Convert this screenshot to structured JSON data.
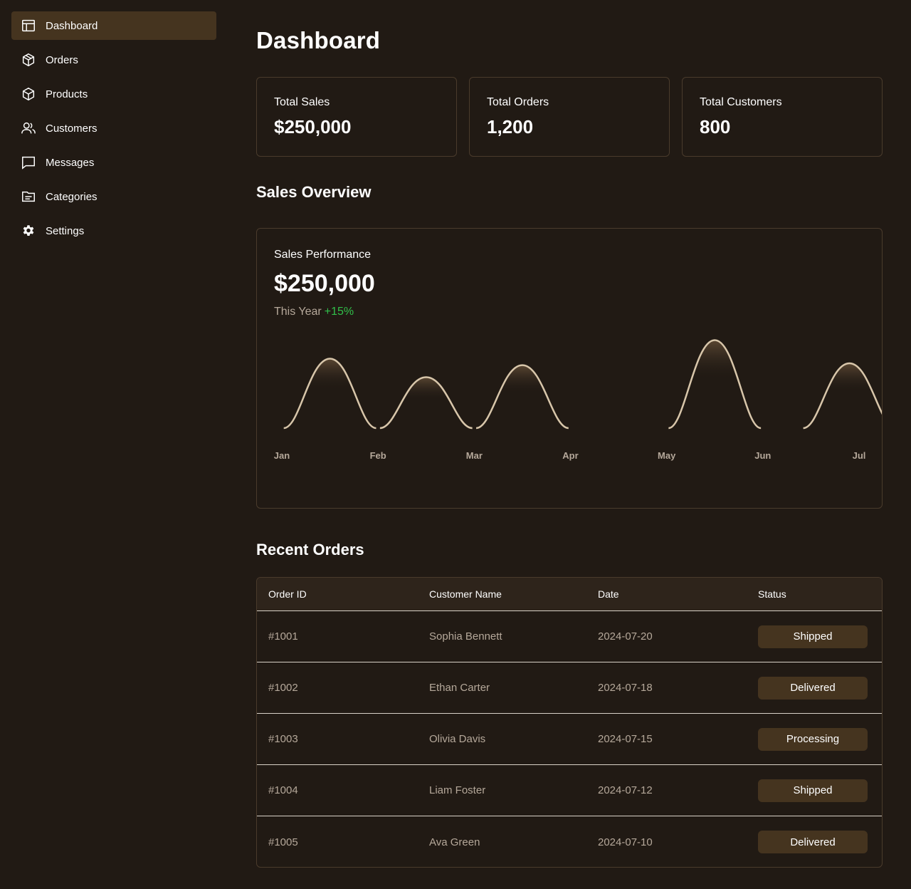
{
  "sidebar": {
    "items": [
      {
        "label": "Dashboard",
        "icon": "layout-icon",
        "active": true
      },
      {
        "label": "Orders",
        "icon": "box-icon",
        "active": false
      },
      {
        "label": "Products",
        "icon": "cube-icon",
        "active": false
      },
      {
        "label": "Customers",
        "icon": "users-icon",
        "active": false
      },
      {
        "label": "Messages",
        "icon": "message-icon",
        "active": false
      },
      {
        "label": "Categories",
        "icon": "folder-icon",
        "active": false
      },
      {
        "label": "Settings",
        "icon": "gear-icon",
        "active": false
      }
    ]
  },
  "page": {
    "title": "Dashboard"
  },
  "stats": [
    {
      "label": "Total Sales",
      "value": "$250,000"
    },
    {
      "label": "Total Orders",
      "value": "1,200"
    },
    {
      "label": "Total Customers",
      "value": "800"
    }
  ],
  "sales_overview": {
    "title": "Sales Overview",
    "card_title": "Sales Performance",
    "total": "$250,000",
    "period": "This Year",
    "change": "+15%"
  },
  "chart_data": {
    "type": "area",
    "categories": [
      "Jan",
      "Feb",
      "Mar",
      "Apr",
      "May",
      "Jun",
      "Jul"
    ],
    "series": [
      {
        "values": [
          0,
          75,
          55,
          68,
          0,
          95,
          70
        ]
      }
    ],
    "grid": false,
    "legend": "none"
  },
  "recent_orders": {
    "title": "Recent Orders",
    "columns": [
      "Order ID",
      "Customer Name",
      "Date",
      "Status"
    ],
    "rows": [
      {
        "id": "#1001",
        "customer": "Sophia Bennett",
        "date": "2024-07-20",
        "status": "Shipped"
      },
      {
        "id": "#1002",
        "customer": "Ethan Carter",
        "date": "2024-07-18",
        "status": "Delivered"
      },
      {
        "id": "#1003",
        "customer": "Olivia Davis",
        "date": "2024-07-15",
        "status": "Processing"
      },
      {
        "id": "#1004",
        "customer": "Liam Foster",
        "date": "2024-07-12",
        "status": "Shipped"
      },
      {
        "id": "#1005",
        "customer": "Ava Green",
        "date": "2024-07-10",
        "status": "Delivered"
      }
    ]
  },
  "colors": {
    "background": "#211a14",
    "accent": "#45341f",
    "border": "#4a3b2c",
    "chart_line": "#d8c6aa",
    "positive": "#31c04a"
  }
}
